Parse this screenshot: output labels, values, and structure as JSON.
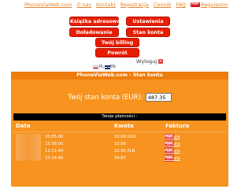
{
  "topnav": {
    "site": "PhoneViaWeb.com",
    "about": "O nas",
    "contact": "Kontakt",
    "register": "Rejestracja",
    "prices": "Cennik",
    "faq": "FAQ",
    "terms_icon": "PDF",
    "terms": "Regulamin"
  },
  "menu": {
    "address_book": "Książka adresowa",
    "settings": "Ustawienia",
    "topup": "Doładowanie",
    "balance": "Stan konta",
    "billing": "Twój billing",
    "back": "Powrót"
  },
  "lang": {
    "pl": "PL",
    "en": "EN"
  },
  "logout": "Wyloguj",
  "panel": {
    "title": "PhoneViaWeb.com - Stan konta",
    "balance_label": "Twój stan konta (EUR):",
    "balance_value": "487.35",
    "payments_title": "Twoje płatności :"
  },
  "table": {
    "headers": {
      "date": "Data",
      "amount": "Kwota",
      "invoice": "Faktura"
    },
    "rows": [
      {
        "time": "20:55:06",
        "amount": "50.00 USD",
        "pdf": "PDF",
        "invoice": "Faktura"
      },
      {
        "time": "15:58:05",
        "amount": "10.00",
        "pdf": "PDF",
        "invoice": "Faktura"
      },
      {
        "time": "11:11:44",
        "amount": "10.00 PLN",
        "pdf": "PDF",
        "invoice": "Faktura"
      },
      {
        "time": "10:14:40",
        "amount": "24.87",
        "pdf": "PDF",
        "invoice": "Faktura"
      }
    ]
  },
  "colors": {
    "accent": "#f7931e",
    "button": "#e81e04",
    "link": "#e8822a"
  }
}
